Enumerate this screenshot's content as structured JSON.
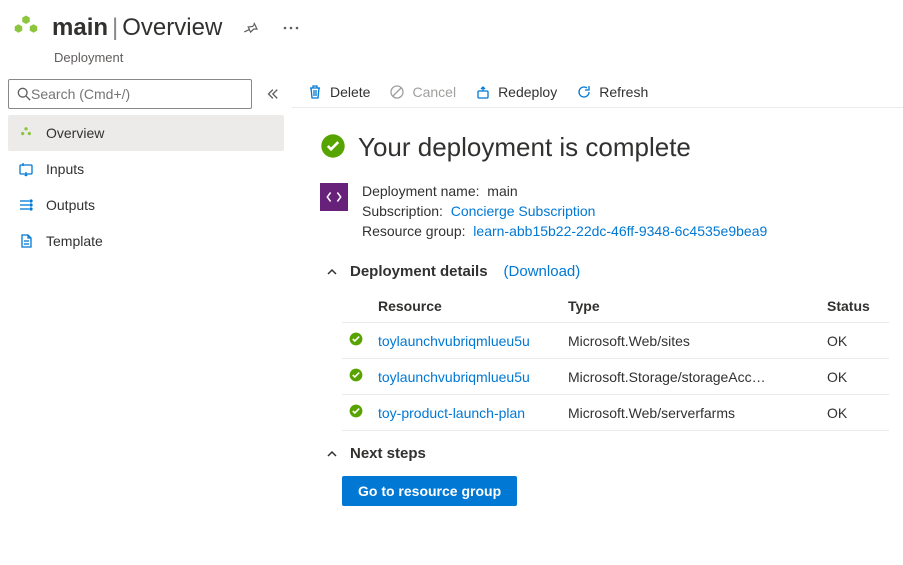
{
  "header": {
    "title_bold": "main",
    "title_rest": "Overview",
    "subtitle": "Deployment"
  },
  "sidebar": {
    "search_placeholder": "Search (Cmd+/)",
    "items": [
      {
        "label": "Overview",
        "active": true
      },
      {
        "label": "Inputs"
      },
      {
        "label": "Outputs"
      },
      {
        "label": "Template"
      }
    ]
  },
  "toolbar": {
    "delete": "Delete",
    "cancel": "Cancel",
    "redeploy": "Redeploy",
    "refresh": "Refresh"
  },
  "status": {
    "title": "Your deployment is complete"
  },
  "meta": {
    "deployment_name_label": "Deployment name:",
    "deployment_name_value": "main",
    "subscription_label": "Subscription:",
    "subscription_value": "Concierge Subscription",
    "resource_group_label": "Resource group:",
    "resource_group_value": "learn-abb15b22-22dc-46ff-9348-6c4535e9bea9"
  },
  "details": {
    "section_title": "Deployment details",
    "download_label": "(Download)",
    "columns": {
      "resource": "Resource",
      "type": "Type",
      "status": "Status"
    },
    "rows": [
      {
        "resource": "toylaunchvubriqmlueu5u",
        "type": "Microsoft.Web/sites",
        "status": "OK"
      },
      {
        "resource": "toylaunchvubriqmlueu5u",
        "type": "Microsoft.Storage/storageAcc…",
        "status": "OK"
      },
      {
        "resource": "toy-product-launch-plan",
        "type": "Microsoft.Web/serverfarms",
        "status": "OK"
      }
    ]
  },
  "next": {
    "section_title": "Next steps",
    "cta_label": "Go to resource group"
  },
  "colors": {
    "accent": "#0078d4",
    "success": "#57a300",
    "purple": "#68217a"
  }
}
